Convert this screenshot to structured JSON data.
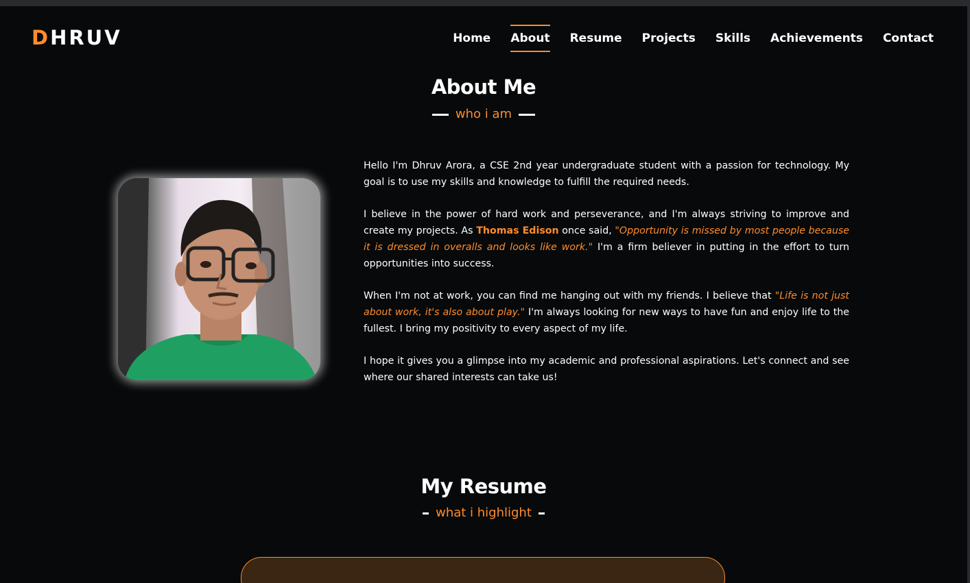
{
  "header": {
    "logo_first": "D",
    "logo_rest": "HRUV",
    "nav": [
      {
        "label": "Home"
      },
      {
        "label": "About"
      },
      {
        "label": "Resume"
      },
      {
        "label": "Projects"
      },
      {
        "label": "Skills"
      },
      {
        "label": "Achievements"
      },
      {
        "label": "Contact"
      }
    ],
    "active_nav": "About"
  },
  "about": {
    "title": "About Me",
    "subtitle": "who i am",
    "photo_alt": "profile-photo",
    "p1": "Hello I'm Dhruv Arora, a CSE 2nd year undergraduate student with a passion for technology. My goal is to use my skills and knowledge to fulfill the required needs.",
    "p2_a": "I believe in the power of hard work and perseverance, and I'm always striving to improve and create my projects. As ",
    "p2_name": "Thomas Edison",
    "p2_b": " once said, ",
    "p2_quote": "\"Opportunity is missed by most people because it is dressed in overalls and looks like work.\"",
    "p2_c": " I'm a firm believer in putting in the effort to turn opportunities into success.",
    "p3_a": "When I'm not at work, you can find me hanging out with my friends. I believe that ",
    "p3_quote": "\"Life is not just about work, it's also about play.\"",
    "p3_b": " I'm always looking for new ways to have fun and enjoy life to the fullest. I bring my positivity to every aspect of my life.",
    "p4": "I hope it gives you a glimpse into my academic and professional aspirations. Let's connect and see where our shared interests can take us!"
  },
  "resume": {
    "title": "My Resume",
    "subtitle": "what i highlight"
  },
  "colors": {
    "accent": "#ff8c2e",
    "background": "#07090a",
    "card": "#3a2613"
  }
}
